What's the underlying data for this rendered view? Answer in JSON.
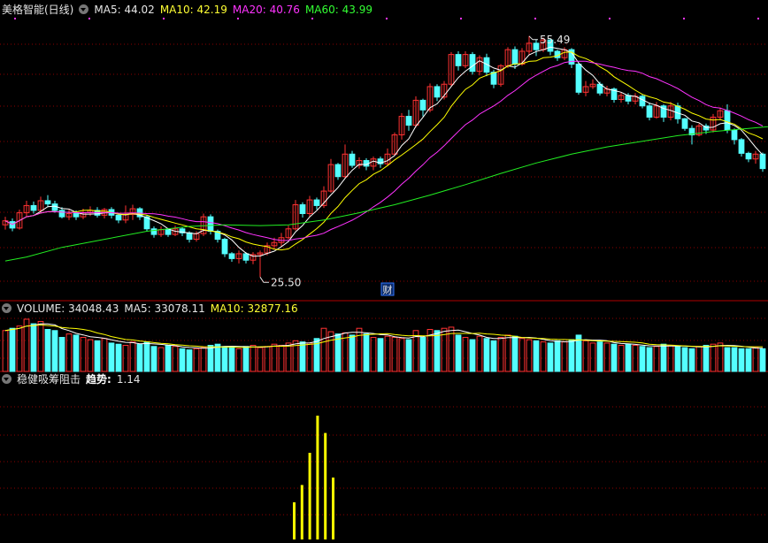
{
  "colors": {
    "up": "#ff3232",
    "down": "#54ffff",
    "ma5": "#ffffff",
    "ma10": "#ffff00",
    "ma20": "#ff33ff",
    "ma60": "#22ee22",
    "grid": "#8b0000",
    "signal_bar": "#ffff00",
    "background": "#000000"
  },
  "price_panel": {
    "title": "美格智能(日线)",
    "ma5_label": "MA5:",
    "ma5_value": "44.02",
    "ma10_label": "MA10:",
    "ma10_value": "42.19",
    "ma20_label": "MA20:",
    "ma20_value": "40.76",
    "ma60_label": "MA60:",
    "ma60_value": "43.99",
    "high_label": "55.49",
    "low_label": "25.50",
    "finance_marker": "财"
  },
  "volume_panel": {
    "label": "VOLUME:",
    "value": "34048.43",
    "ma5_label": "MA5:",
    "ma5_value": "33078.11",
    "ma10_label": "MA10:",
    "ma10_value": "32877.16"
  },
  "indicator_panel": {
    "name": "稳健吸筹阻击",
    "trend_label": "趋势:",
    "trend_value": "1.14",
    "signal_bars": [
      0.3,
      0.44,
      0.7,
      1.0,
      0.86,
      0.5
    ]
  },
  "chart_data": [
    {
      "type": "candlestick",
      "title": "美格智能(日线)",
      "ylim": [
        23,
        58
      ],
      "series": [
        {
          "name": "MA5",
          "last": 44.02
        },
        {
          "name": "MA10",
          "last": 42.19
        },
        {
          "name": "MA20",
          "last": 40.76
        },
        {
          "name": "MA60",
          "last": 43.99
        }
      ],
      "annotations": [
        {
          "text": "55.49",
          "value": 55.49
        },
        {
          "text": "25.50",
          "value": 25.5
        }
      ],
      "candles": [
        [
          32.0,
          32.5,
          31.4,
          33.0
        ],
        [
          32.4,
          31.6,
          31.2,
          32.8
        ],
        [
          31.6,
          33.5,
          31.4,
          33.9
        ],
        [
          33.5,
          34.4,
          33.0,
          35.0
        ],
        [
          34.4,
          33.8,
          33.4,
          34.9
        ],
        [
          33.8,
          35.0,
          33.5,
          35.5
        ],
        [
          35.0,
          34.6,
          34.2,
          35.7
        ],
        [
          34.6,
          33.8,
          33.5,
          35.0
        ],
        [
          33.8,
          33.0,
          32.8,
          34.2
        ],
        [
          33.0,
          33.4,
          32.6,
          33.9
        ],
        [
          33.4,
          33.0,
          32.6,
          33.8
        ],
        [
          33.0,
          33.5,
          32.7,
          34.0
        ],
        [
          33.5,
          33.8,
          33.1,
          34.3
        ],
        [
          33.8,
          33.2,
          32.9,
          34.2
        ],
        [
          33.2,
          33.9,
          32.8,
          34.1
        ],
        [
          33.9,
          33.2,
          32.8,
          34.2
        ],
        [
          33.2,
          32.6,
          32.2,
          33.5
        ],
        [
          32.6,
          33.3,
          32.2,
          34.4
        ],
        [
          33.3,
          34.0,
          32.6,
          34.5
        ],
        [
          34.0,
          33.0,
          32.6,
          34.2
        ],
        [
          33.0,
          31.5,
          31.2,
          33.2
        ],
        [
          31.5,
          30.8,
          30.4,
          31.8
        ],
        [
          30.8,
          31.4,
          30.5,
          31.8
        ],
        [
          31.4,
          30.8,
          30.5,
          31.6
        ],
        [
          30.8,
          31.5,
          30.6,
          31.9
        ],
        [
          31.5,
          31.0,
          30.6,
          31.7
        ],
        [
          31.0,
          30.2,
          29.8,
          31.2
        ],
        [
          30.2,
          30.9,
          29.9,
          31.2
        ],
        [
          30.9,
          33.0,
          30.6,
          33.4
        ],
        [
          33.0,
          31.2,
          30.8,
          33.3
        ],
        [
          31.2,
          30.2,
          29.8,
          31.4
        ],
        [
          30.2,
          28.4,
          28.0,
          30.4
        ],
        [
          28.4,
          27.8,
          27.4,
          28.6
        ],
        [
          27.8,
          28.4,
          27.2,
          28.8
        ],
        [
          28.4,
          27.6,
          27.2,
          28.6
        ],
        [
          27.6,
          28.3,
          27.1,
          28.6
        ],
        [
          28.3,
          28.5,
          25.5,
          28.8
        ],
        [
          28.5,
          29.4,
          28.2,
          29.8
        ],
        [
          29.4,
          29.8,
          29.0,
          30.4
        ],
        [
          29.8,
          30.4,
          29.3,
          31.0
        ],
        [
          30.4,
          31.5,
          30.2,
          31.9
        ],
        [
          31.5,
          34.5,
          31.3,
          35.1
        ],
        [
          34.5,
          33.4,
          32.9,
          34.8
        ],
        [
          33.4,
          35.1,
          33.0,
          35.6
        ],
        [
          35.1,
          34.4,
          33.9,
          35.4
        ],
        [
          34.4,
          36.2,
          34.1,
          36.8
        ],
        [
          36.2,
          39.5,
          36.0,
          40.2
        ],
        [
          39.5,
          38.0,
          37.6,
          39.7
        ],
        [
          38.0,
          40.8,
          37.8,
          42.0
        ],
        [
          40.8,
          39.4,
          39.1,
          41.2
        ],
        [
          39.4,
          40.0,
          39.0,
          40.4
        ],
        [
          40.0,
          39.3,
          38.8,
          40.3
        ],
        [
          39.3,
          40.2,
          38.8,
          40.5
        ],
        [
          40.2,
          39.6,
          39.1,
          40.5
        ],
        [
          39.6,
          40.8,
          39.3,
          41.5
        ],
        [
          40.8,
          43.2,
          40.6,
          43.5
        ],
        [
          43.2,
          45.5,
          42.6,
          45.9
        ],
        [
          45.5,
          44.4,
          43.7,
          46.3
        ],
        [
          44.4,
          47.5,
          44.1,
          48.0
        ],
        [
          47.5,
          46.3,
          45.5,
          47.7
        ],
        [
          46.3,
          49.2,
          46.0,
          49.6
        ],
        [
          49.2,
          47.9,
          47.4,
          49.5
        ],
        [
          47.9,
          49.5,
          47.6,
          49.9
        ],
        [
          49.5,
          53.2,
          49.2,
          53.5
        ],
        [
          53.2,
          51.8,
          51.2,
          53.6
        ],
        [
          51.8,
          53.2,
          51.5,
          53.6
        ],
        [
          53.2,
          51.1,
          50.7,
          53.5
        ],
        [
          51.1,
          52.8,
          50.6,
          53.1
        ],
        [
          52.8,
          51.0,
          50.5,
          53.3
        ],
        [
          51.0,
          49.5,
          49.0,
          51.3
        ],
        [
          49.5,
          51.8,
          49.2,
          52.0
        ],
        [
          51.8,
          53.8,
          51.5,
          54.1
        ],
        [
          53.8,
          52.0,
          51.4,
          54.2
        ],
        [
          52.0,
          53.6,
          51.8,
          54.0
        ],
        [
          53.6,
          54.6,
          53.2,
          55.49
        ],
        [
          54.6,
          53.8,
          53.0,
          55.1
        ],
        [
          53.8,
          55.0,
          53.5,
          55.3
        ],
        [
          55.0,
          53.6,
          53.1,
          55.2
        ],
        [
          53.6,
          52.8,
          52.4,
          53.8
        ],
        [
          52.8,
          53.8,
          52.5,
          54.1
        ],
        [
          53.8,
          52.0,
          51.5,
          54.0
        ],
        [
          52.0,
          48.5,
          48.2,
          52.2
        ],
        [
          48.5,
          49.2,
          48.0,
          49.9
        ],
        [
          49.2,
          49.5,
          48.9,
          50.1
        ],
        [
          49.5,
          48.4,
          48.1,
          49.8
        ],
        [
          48.4,
          48.9,
          48.0,
          49.3
        ],
        [
          48.9,
          47.6,
          47.2,
          49.1
        ],
        [
          47.6,
          48.1,
          47.2,
          48.5
        ],
        [
          48.1,
          47.4,
          47.0,
          48.4
        ],
        [
          47.4,
          48.0,
          47.0,
          48.4
        ],
        [
          48.0,
          46.8,
          46.5,
          48.2
        ],
        [
          46.8,
          45.4,
          45.0,
          47.2
        ],
        [
          45.4,
          46.8,
          45.2,
          47.3
        ],
        [
          46.8,
          45.4,
          44.8,
          47.0
        ],
        [
          45.4,
          46.8,
          45.0,
          47.3
        ],
        [
          46.8,
          45.2,
          44.6,
          47.2
        ],
        [
          45.2,
          44.0,
          43.7,
          45.3
        ],
        [
          44.0,
          43.2,
          42.0,
          44.4
        ],
        [
          43.2,
          44.3,
          43.0,
          44.6
        ],
        [
          44.3,
          43.8,
          43.3,
          44.6
        ],
        [
          43.8,
          45.4,
          43.5,
          45.8
        ],
        [
          45.4,
          46.2,
          45.0,
          46.6
        ],
        [
          46.2,
          43.8,
          43.4,
          47.0
        ],
        [
          43.8,
          42.6,
          42.0,
          44.0
        ],
        [
          42.6,
          40.9,
          40.5,
          42.8
        ],
        [
          40.9,
          40.2,
          39.8,
          41.1
        ],
        [
          40.2,
          40.8,
          39.6,
          41.2
        ],
        [
          40.8,
          39.0,
          38.6,
          41.0
        ]
      ],
      "ma60": [
        [
          0,
          27.5
        ],
        [
          3,
          28.0
        ],
        [
          8,
          29.2
        ],
        [
          14,
          30.2
        ],
        [
          20,
          31.2
        ],
        [
          26,
          31.8
        ],
        [
          31,
          32.0
        ],
        [
          36,
          31.9
        ],
        [
          40,
          32.0
        ],
        [
          45,
          32.6
        ],
        [
          50,
          33.5
        ],
        [
          55,
          34.5
        ],
        [
          60,
          35.7
        ],
        [
          65,
          37.0
        ],
        [
          70,
          38.4
        ],
        [
          75,
          39.7
        ],
        [
          80,
          40.8
        ],
        [
          85,
          41.7
        ],
        [
          90,
          42.4
        ],
        [
          95,
          43.1
        ],
        [
          100,
          43.6
        ],
        [
          105,
          44.0
        ],
        [
          110,
          44.4
        ]
      ]
    },
    {
      "type": "bar",
      "title": "VOLUME",
      "value": 34048.43,
      "ma5": 33078.11,
      "ma10": 32877.16,
      "values": [
        36000,
        38000,
        40000,
        46000,
        42000,
        44000,
        37000,
        36000,
        30000,
        33000,
        32000,
        30000,
        28000,
        27000,
        29000,
        25000,
        24000,
        23000,
        26000,
        24000,
        26000,
        22000,
        21000,
        23000,
        22000,
        20000,
        19000,
        20000,
        21000,
        23000,
        24000,
        22000,
        21000,
        20000,
        22000,
        23000,
        21000,
        22000,
        24000,
        23000,
        25000,
        27000,
        26000,
        25000,
        29000,
        38000,
        35000,
        33000,
        34000,
        32000,
        38000,
        33000,
        30000,
        29000,
        31000,
        30000,
        29000,
        28000,
        36000,
        30000,
        37000,
        36000,
        38000,
        39000,
        32000,
        30000,
        28000,
        31000,
        29000,
        27000,
        30000,
        32000,
        31000,
        29000,
        28000,
        27000,
        26000,
        25000,
        27000,
        26000,
        28000,
        32000,
        27000,
        25000,
        26000,
        25000,
        24000,
        23000,
        24000,
        23000,
        22000,
        21000,
        22000,
        24000,
        23000,
        22000,
        21000,
        20000,
        22000,
        23000,
        24000,
        25000,
        21000,
        21000,
        20000,
        20000,
        21000,
        20000,
        21000,
        20000
      ]
    },
    {
      "type": "bar",
      "title": "稳健吸筹阻击",
      "trend": 1.14,
      "values": [
        0.3,
        0.44,
        0.7,
        1.0,
        0.86,
        0.5
      ]
    }
  ]
}
